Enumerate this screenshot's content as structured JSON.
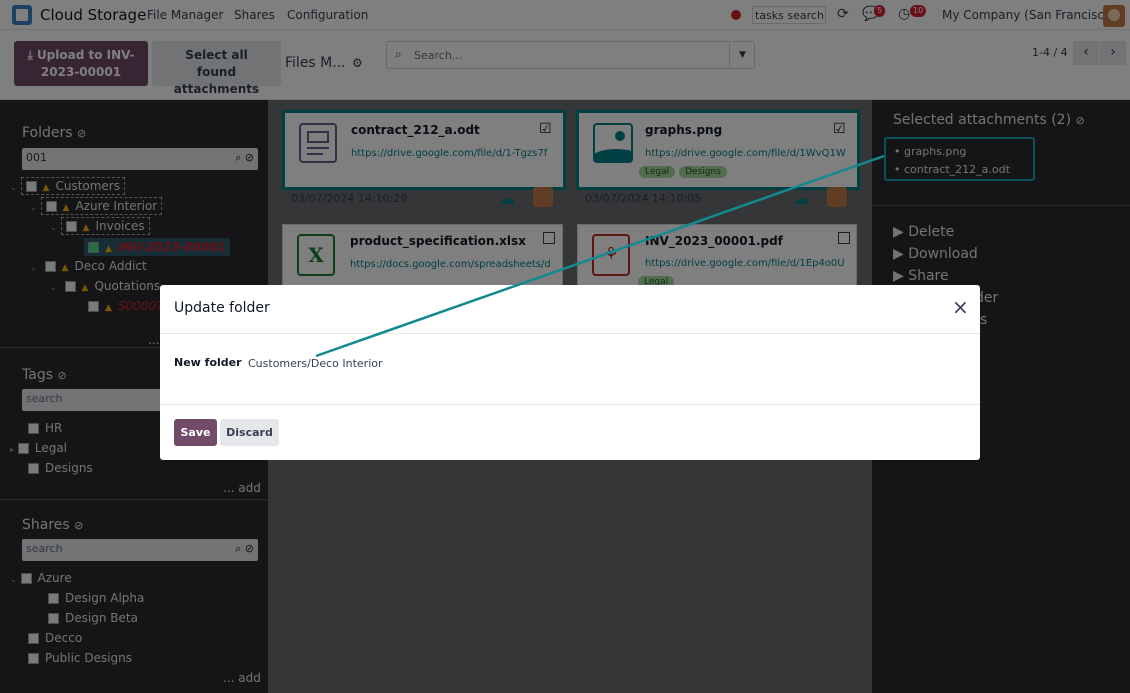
{
  "app": {
    "name": "Cloud Storage"
  },
  "nav": {
    "items": [
      "File Manager",
      "Shares",
      "Configuration"
    ],
    "tasks_search": "tasks search",
    "messages_count": "5",
    "activities_count": "10",
    "company": "My Company (San Francisco)"
  },
  "control_panel": {
    "upload_label": "Upload to INV-2023-00001",
    "select_all_label": "Select all found attachments",
    "breadcrumb": "Files M...",
    "search_placeholder": "Search...",
    "pager": "1-4 / 4"
  },
  "folders": {
    "title": "Folders",
    "search_value": "001",
    "tree": [
      {
        "label": "Customers"
      },
      {
        "label": "Azure Interior"
      },
      {
        "label": "Invoices"
      },
      {
        "label": "INV-2023-00001"
      },
      {
        "label": "Deco Addict"
      },
      {
        "label": "Quotations"
      },
      {
        "label": "S00007"
      }
    ],
    "more": "..."
  },
  "tags": {
    "title": "Tags",
    "search_placeholder": "search",
    "items": [
      "HR",
      "Legal",
      "Designs"
    ],
    "add_label": "... add"
  },
  "shares": {
    "title": "Shares",
    "search_placeholder": "search",
    "items": [
      "Azure",
      "Design Alpha",
      "Design Beta",
      "Decco",
      "Public Designs"
    ],
    "add_label": "... add"
  },
  "attachments": [
    {
      "name": "contract_212_a.odt",
      "url": "https://drive.google.com/file/d/1-Tgzs7f",
      "date": "03/07/2024 14:10:29",
      "tags": []
    },
    {
      "name": "graphs.png",
      "url": "https://drive.google.com/file/d/1WvQ1W",
      "date": "03/07/2024 14:10:05",
      "tags": [
        "Legal",
        "Designs"
      ]
    },
    {
      "name": "product_specification.xlsx",
      "url": "https://docs.google.com/spreadsheets/d",
      "tags": []
    },
    {
      "name": "INV_2023_00001.pdf",
      "url": "https://drive.google.com/file/d/1Ep4o0U",
      "tags": [
        "Legal"
      ]
    }
  ],
  "selection": {
    "title": "Selected attachments (2)",
    "items": [
      "graphs.png",
      "contract_212_a.odt"
    ],
    "actions": [
      "Delete",
      "Download",
      "Share",
      "Move to folder",
      "Update tags"
    ],
    "actions_visible": [
      "Delete",
      "Download",
      "Share",
      "der",
      "s"
    ]
  },
  "modal": {
    "title": "Update folder",
    "field_label": "New folder",
    "field_value": "Customers/Deco Interior",
    "save_label": "Save",
    "discard_label": "Discard"
  },
  "colors": {
    "primary": "#714b67",
    "accent": "#017e84",
    "dark": "#2a2b2f"
  }
}
